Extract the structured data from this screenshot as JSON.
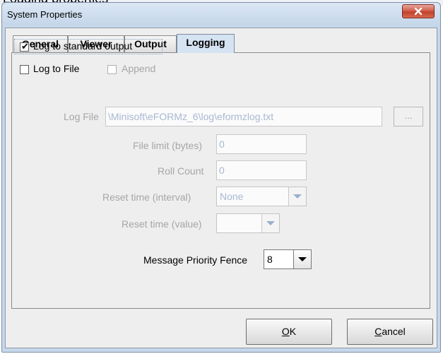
{
  "window": {
    "title": "System Properties"
  },
  "tabs": [
    {
      "label": "General"
    },
    {
      "label": "Viewer"
    },
    {
      "label": "Output"
    },
    {
      "label": "Logging"
    }
  ],
  "logging": {
    "log_stdout_label": "Log to standard output",
    "log_stdout_checked": true,
    "log_file_label": "Log to File",
    "append_label": "Append",
    "log_file_field_label": "Log File",
    "log_file_path": "\\Minisoft\\eFORMz_6\\log\\eformzlog.txt",
    "browse_label": "...",
    "file_limit_label": "File limit (bytes)",
    "file_limit_value": "0",
    "roll_count_label": "Roll Count",
    "roll_count_value": "0",
    "reset_interval_label": "Reset time (interval)",
    "reset_interval_value": "None",
    "reset_value_label": "Reset time (value)",
    "reset_value_value": "",
    "priority_label": "Message Priority Fence",
    "priority_value": "8"
  },
  "buttons": {
    "ok_mnemonic": "O",
    "ok_rest": "K",
    "cancel_mnemonic": "C",
    "cancel_rest": "ancel"
  }
}
